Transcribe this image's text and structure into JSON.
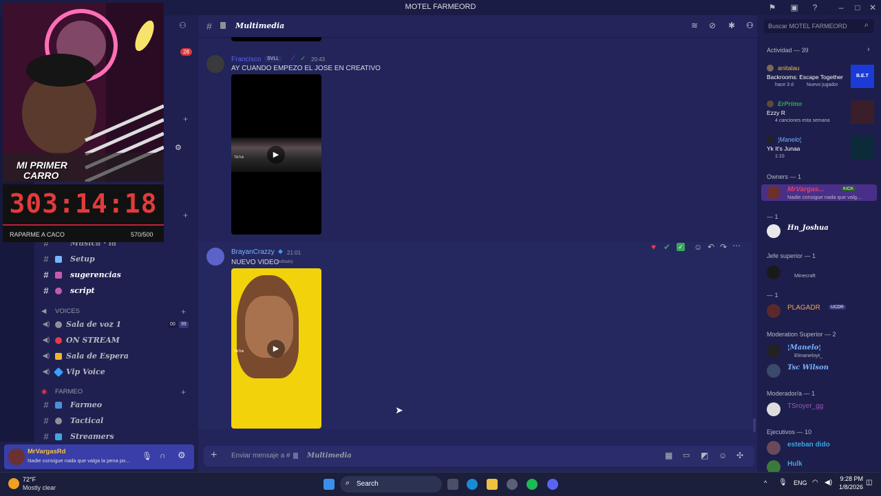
{
  "window": {
    "title": "MOTEL FARMEORD"
  },
  "header": {
    "channel_name": "Multimedia"
  },
  "search": {
    "placeholder": "Buscar MOTEL FARMEORD"
  },
  "server_badge": "28",
  "webcam": {
    "overlay_text_1": "MI PRIMER",
    "overlay_text_2": "CARRO"
  },
  "timer": {
    "value": "303:14:18",
    "goal_label": "RAPARME A CACO",
    "goal_count": "570/500"
  },
  "channels": {
    "partial_top": "Musica · la",
    "items": [
      {
        "label": "Setup",
        "color": "#7ab4ff"
      },
      {
        "label": "sugerencias",
        "color": "#c45ab0"
      },
      {
        "label": "script",
        "color": "#c45ab0"
      }
    ],
    "voices_category": "VOICES",
    "voice_items": [
      {
        "label": "Sala de voz 1",
        "color": "#8e9297"
      },
      {
        "label": "ON STREAM",
        "color": "#e23b4a"
      },
      {
        "label": "Sala de Espera",
        "color": "#f0b432"
      },
      {
        "label": "Vip Voice",
        "color": "#38a0ff"
      }
    ],
    "voice_counts": [
      "00",
      "99"
    ],
    "farmeo_category": "FARMEO",
    "farmeo_items": [
      {
        "label": "Farmeo",
        "color": "#4a90d9"
      },
      {
        "label": "Tactical",
        "color": "#8e9297"
      },
      {
        "label": "Streamers",
        "color": "#3ba7e0"
      }
    ]
  },
  "user_panel": {
    "name": "MrVargasRd",
    "status": "Nadie consigue nada que valga la pena po..."
  },
  "messages": [
    {
      "author": "Francisco",
      "tag": "SVLL",
      "time": "20:43",
      "text": "AY CUANDO EMPEZO EL JOSE EN CREATIVO",
      "author_color": "#5865f2",
      "video_label": "TikTok"
    },
    {
      "author": "BrayanCrazzy",
      "time": "21:01",
      "text": "NUEVO VIDEO",
      "edited": "(editado)",
      "author_color": "#7ab4ff",
      "video_label": "TikTok"
    }
  ],
  "composer": {
    "placeholder_prefix": "Enviar mensaje a #",
    "channel": "Multimedia"
  },
  "activity": {
    "title": "Actividad — 39",
    "items": [
      {
        "user": "anitalau",
        "title": "Backrooms: Escape Together",
        "sub": "hace 3 d",
        "sub2": "Nuevo jugador",
        "thumb": "B.E.T",
        "color": "#e3b84a"
      },
      {
        "user": "ErPrimo",
        "title": "Ezzy R",
        "sub": "4 canciones esta semana",
        "color": "#3ba55d"
      },
      {
        "user": "¦Manelo¦",
        "title": "Yk It's Junaa",
        "sub": "1:10",
        "color": "#7ab4ff"
      }
    ]
  },
  "roles": [
    {
      "header": "Owners — 1",
      "members": [
        {
          "name": "MrVargas...",
          "sub": "Nadie consigue nada que valg...",
          "badge": "KICK",
          "color": "#e2406a"
        }
      ]
    },
    {
      "header": "— 1",
      "members": [
        {
          "name": "Hn_Joshua",
          "sub": "",
          "color": "#ffffff"
        }
      ]
    },
    {
      "header": "Jefe superior — 1",
      "members": [
        {
          "name": "",
          "sub": "Minecraft",
          "color": "#ffffff"
        }
      ]
    },
    {
      "header": "— 1",
      "members": [
        {
          "name": "PLAGADR",
          "sub": "",
          "badge": "UCDR",
          "color": "#f0a35a"
        }
      ]
    },
    {
      "header": "Moderation Superior — 2",
      "members": [
        {
          "name": "¦Manelo¦",
          "sub": "Elmaneloyt_",
          "color": "#7ab4ff"
        },
        {
          "name": "Tsc Wilson",
          "sub": "",
          "color": "#7ab4ff"
        }
      ]
    },
    {
      "header": "Moderador/a — 1",
      "members": [
        {
          "name": "TSroyer_gg",
          "sub": "",
          "color": "#9b59b6"
        }
      ]
    },
    {
      "header": "Ejecutivos — 10",
      "members": [
        {
          "name": "esteban dido",
          "sub": "",
          "color": "#3ba7e0"
        },
        {
          "name": "Hulk",
          "sub": "",
          "color": "#3ba7e0"
        }
      ]
    }
  ],
  "taskbar": {
    "weather_temp": "72°F",
    "weather_desc": "Mostly clear",
    "search_label": "Search",
    "lang": "ENG",
    "time": "9:28 PM",
    "date": "1/8/2026"
  }
}
